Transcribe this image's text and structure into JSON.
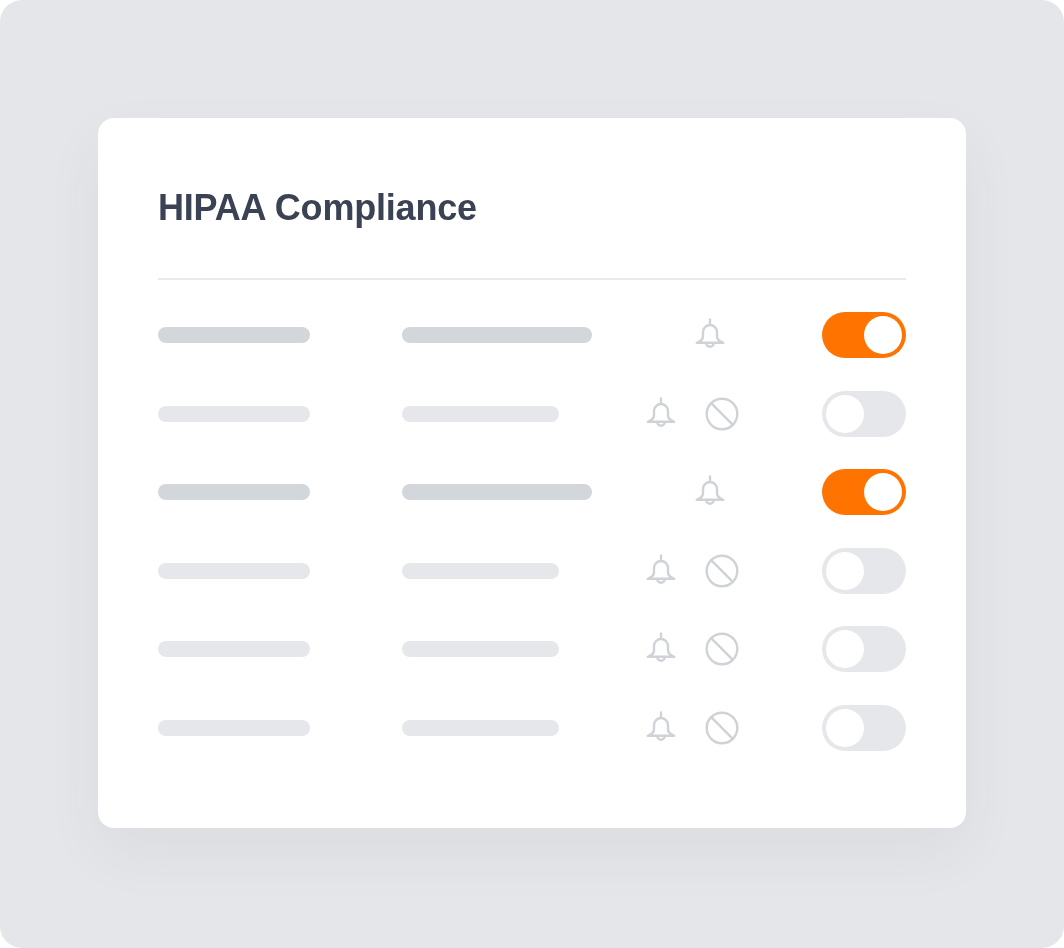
{
  "card": {
    "title": "HIPAA Compliance",
    "rows": [
      {
        "on": true
      },
      {
        "on": false
      },
      {
        "on": true
      },
      {
        "on": false
      },
      {
        "on": false
      },
      {
        "on": false
      }
    ]
  }
}
